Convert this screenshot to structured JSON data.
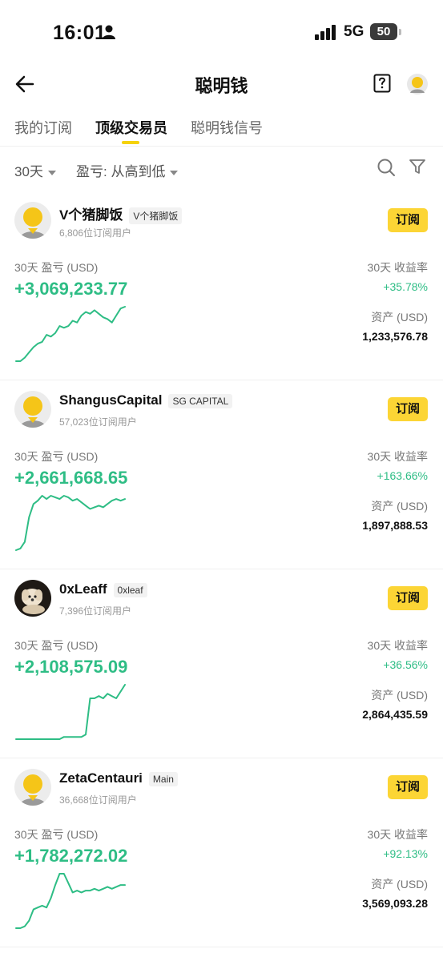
{
  "status_bar": {
    "time": "16:01",
    "network": "5G",
    "battery": "50"
  },
  "header": {
    "title": "聪明钱"
  },
  "tabs": [
    {
      "label": "我的订阅",
      "active": false
    },
    {
      "label": "顶级交易员",
      "active": true
    },
    {
      "label": "聪明钱信号",
      "active": false
    }
  ],
  "filters": {
    "period": "30天",
    "sort": "盈亏: 从高到低"
  },
  "labels": {
    "pnl": "30天 盈亏 (USD)",
    "roi": "30天 收益率",
    "assets": "资产 (USD)",
    "subscribe": "订阅"
  },
  "colors": {
    "accent": "#fcd535",
    "positive": "#2ebd85"
  },
  "traders": [
    {
      "name": "V个猪脚饭",
      "tag": "V个猪脚饭",
      "subscribers": "6,806位订阅用户",
      "pnl": "+3,069,233.77",
      "roi": "+35.78%",
      "assets": "1,233,576.78",
      "avatar": "default-avatar-icon",
      "trend": [
        0,
        0,
        2,
        5,
        8,
        10,
        11,
        15,
        14,
        16,
        20,
        19,
        20,
        23,
        22,
        26,
        28,
        27,
        29,
        27,
        25,
        24,
        22,
        26,
        30,
        31
      ]
    },
    {
      "name": "ShangusCapital",
      "tag": "SG CAPITAL",
      "subscribers": "57,023位订阅用户",
      "pnl": "+2,661,668.65",
      "roi": "+163.66%",
      "assets": "1,897,888.53",
      "avatar": "default-avatar-icon",
      "trend": [
        0,
        1,
        5,
        20,
        28,
        30,
        33,
        31,
        33,
        32,
        31,
        33,
        32,
        30,
        31,
        29,
        27,
        25,
        26,
        27,
        26,
        28,
        30,
        31,
        30,
        31
      ]
    },
    {
      "name": "0xLeaff",
      "tag": "0xleaf",
      "subscribers": "7,396位订阅用户",
      "pnl": "+2,108,575.09",
      "roi": "+36.56%",
      "assets": "2,864,435.59",
      "avatar": "dog-photo-avatar",
      "trend": [
        0,
        0,
        0,
        0,
        0,
        0,
        0,
        0,
        0,
        0,
        0,
        1,
        1,
        1,
        1,
        1,
        2,
        18,
        18,
        19,
        18,
        20,
        19,
        18,
        21,
        24
      ]
    },
    {
      "name": "ZetaCentauri",
      "tag": "Main",
      "subscribers": "36,668位订阅用户",
      "pnl": "+1,782,272.02",
      "roi": "+92.13%",
      "assets": "3,569,093.28",
      "avatar": "default-avatar-icon",
      "trend": [
        0,
        0,
        1,
        4,
        10,
        11,
        12,
        11,
        16,
        23,
        29,
        29,
        24,
        19,
        20,
        19,
        20,
        20,
        21,
        20,
        21,
        22,
        21,
        22,
        23,
        23
      ]
    }
  ]
}
